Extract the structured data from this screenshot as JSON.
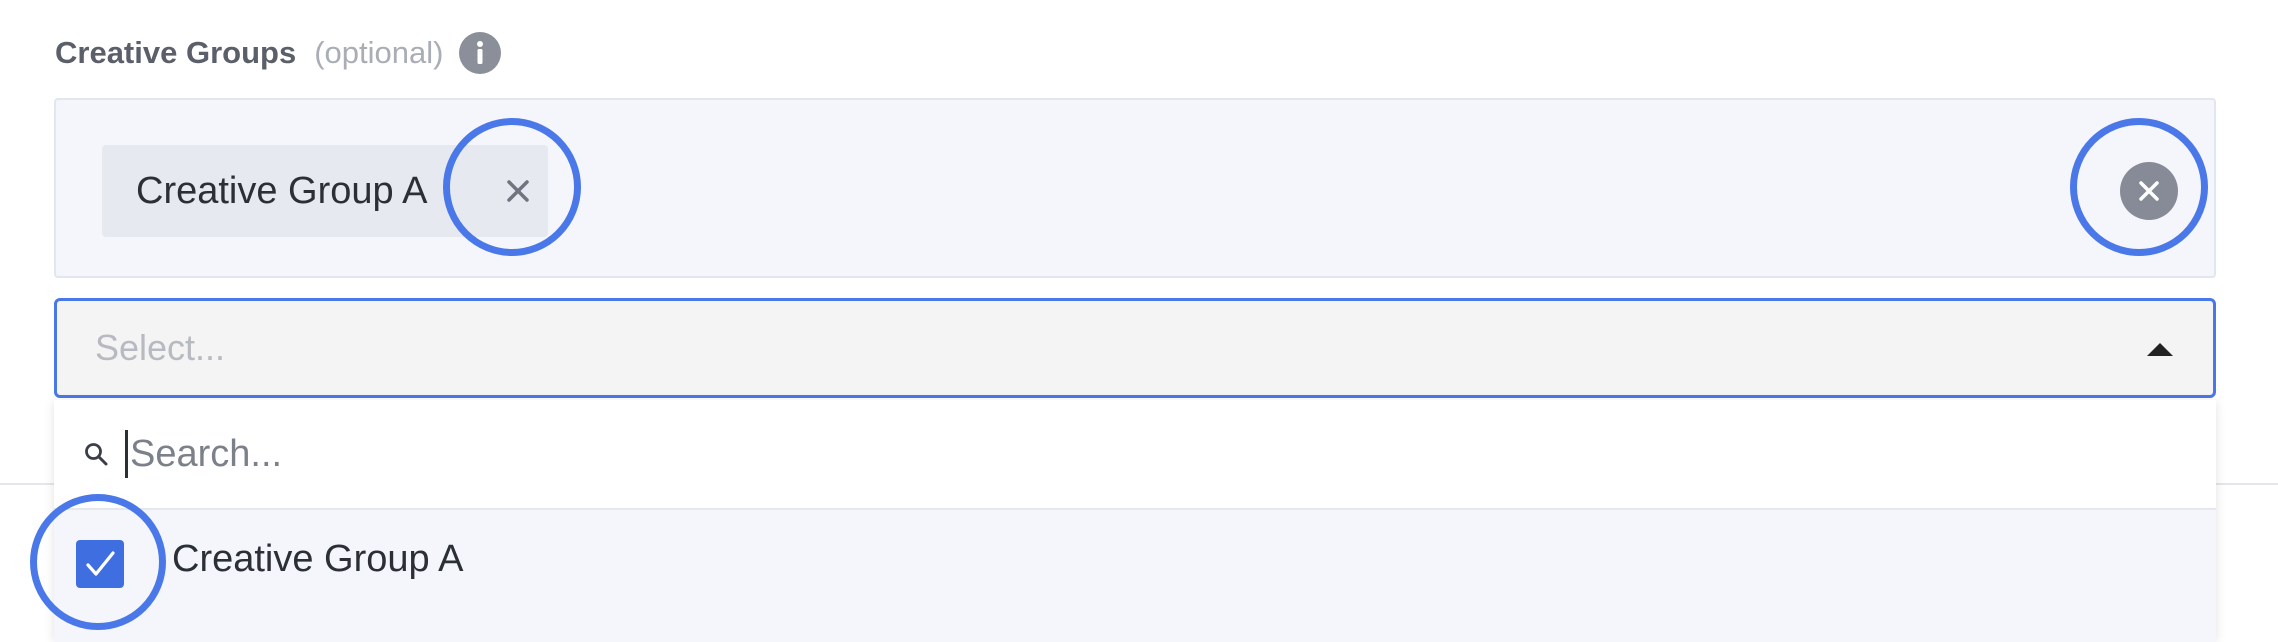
{
  "field": {
    "title": "Creative Groups",
    "optional": "(optional)",
    "info_icon": "info-icon"
  },
  "selected_tags": [
    {
      "label": "Creative Group A",
      "remove_icon": "close-icon"
    }
  ],
  "clear_all_icon": "clear-circle-icon",
  "select": {
    "placeholder": "Select...",
    "arrow_icon": "caret-up-icon"
  },
  "dropdown": {
    "search_placeholder": "Search...",
    "search_icon": "search-icon",
    "options": [
      {
        "label": "Creative Group A",
        "checked": true
      }
    ]
  },
  "colors": {
    "accent": "#4a78e8",
    "checkbox": "#3f6ee0",
    "tags_bg": "#f4f6fb",
    "chip_bg": "#e6e9ef"
  }
}
